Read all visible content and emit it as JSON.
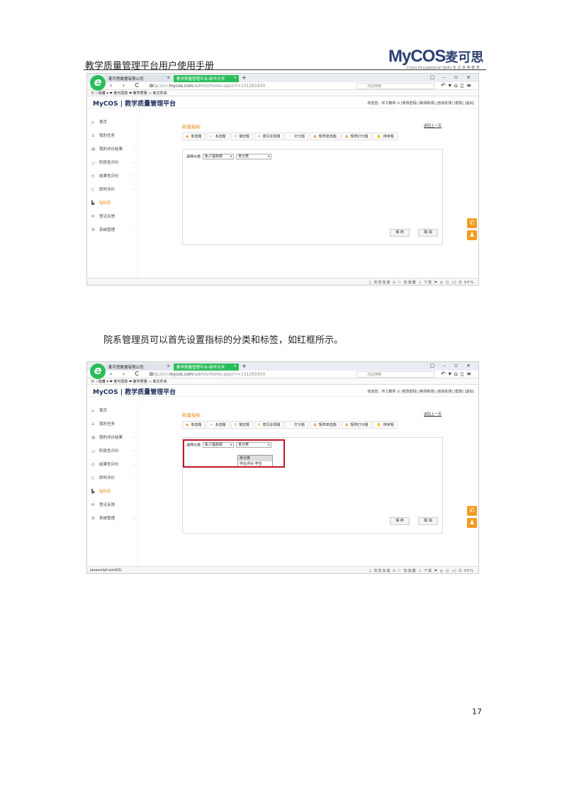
{
  "doc": {
    "header_title": "教学质量管理平台用户使用手册",
    "logo_text": "MyCOS",
    "logo_cn": "麦可思",
    "logo_sub": "China Occupational Skills 专 注 高 等 教 育",
    "caption": "院系管理员可以首先设置指标的分类和标签，如红框所示。",
    "page_number": "17"
  },
  "browser": {
    "tab1": "麦可思数据有限公司",
    "tab2": "教学质量管理平台-新华大学",
    "tab_close": "×",
    "new_tab": "+",
    "url_prefix": "http://cn.",
    "url_host": "mycos.com",
    "url_path": "/admin/Home.aspx?r=131261930",
    "search_placeholder": "点此搜索",
    "bookmarks": "D  ☆收藏 ▾  ❤ 麦可思款  ❤ 教学质量  ▭ 新文件夹",
    "nav": "‹ › C ⌂",
    "window_controls": "▢ – ▫ ×",
    "tools": "↶▾⌂▯≡"
  },
  "app": {
    "logo": "MyCOS | 教学质量管理平台",
    "userbar": "欢迎您，环工教师 ⊙  |修改密码| |新闻新闻| |咨询反馈| |帮助| |退出|",
    "sidebar": [
      {
        "icon": "⌂",
        "label": "首页",
        "arrow": ""
      },
      {
        "icon": "♙",
        "label": "我的任务",
        "arrow": ""
      },
      {
        "icon": "▤",
        "label": "我的评价结果",
        "arrow": "›"
      },
      {
        "icon": "◿",
        "label": "阶段性评价",
        "arrow": "›"
      },
      {
        "icon": "◴",
        "label": "结果性评价",
        "arrow": "›"
      },
      {
        "icon": "▯",
        "label": "即时评价",
        "arrow": "›"
      },
      {
        "icon": "▙",
        "label": "指标库",
        "arrow": ""
      },
      {
        "icon": "✉",
        "label": "意见反馈",
        "arrow": ""
      },
      {
        "icon": "⚙",
        "label": "系统管理",
        "arrow": "›"
      }
    ],
    "form_title": "新建指标",
    "back_link": "返回上一页",
    "question_types": [
      {
        "icon": "◉",
        "label": "单选题"
      },
      {
        "icon": "✔",
        "label": "多选题"
      },
      {
        "icon": "A",
        "label": "填空题"
      },
      {
        "icon": "A",
        "label": "意见反馈题"
      },
      {
        "icon": "☆",
        "label": "打分题"
      },
      {
        "icon": "▦",
        "label": "矩阵单选题"
      },
      {
        "icon": "▦",
        "label": "矩阵打分题"
      },
      {
        "icon": "✋",
        "label": "排序题"
      }
    ],
    "select_label": "选择分类",
    "select1": "私人指标库",
    "select2": "未分类",
    "dropdown_options": [
      "未分类",
      "作业评价-学生"
    ],
    "save": "保 存",
    "cancel": "取 消"
  },
  "statusbar1": {
    "left": "",
    "right": "▯ 浏览加速  ⊙  ⚐ 加速器  ↓ 下载  ⚑  ◎  ◫  ◁)  Q 90%"
  },
  "statusbar2": {
    "left": "javascript:void(0);",
    "right": "▯ 浏览加速  ⊙  ⚐ 加速器  ↓ 下载  ⚑  ◎  ◫  ◁)  Q 90%"
  },
  "float_icons": [
    "✆",
    "♟"
  ]
}
